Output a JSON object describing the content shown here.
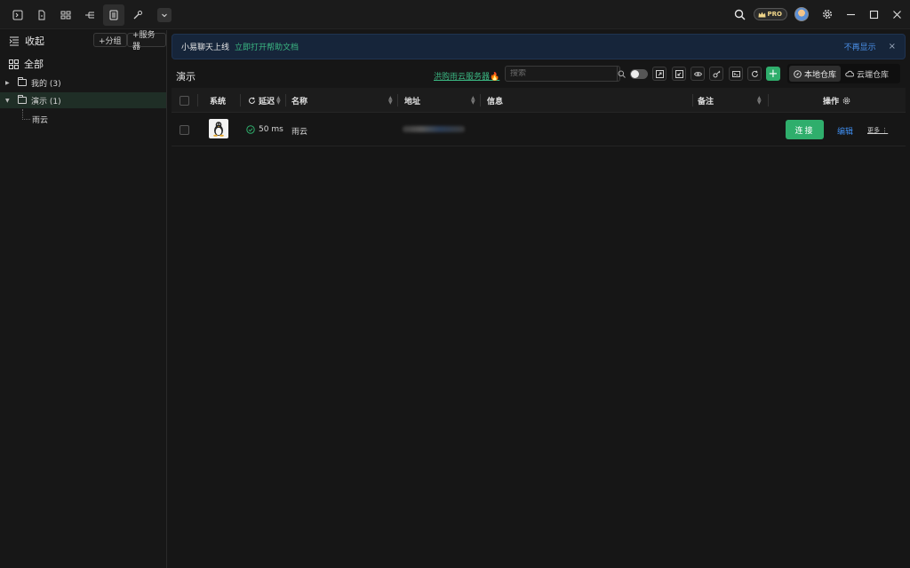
{
  "titlebar": {
    "tabs": [
      {
        "icon": "terminal-icon",
        "active": false
      },
      {
        "icon": "file-icon",
        "active": false
      },
      {
        "icon": "grid-icon",
        "active": false
      },
      {
        "icon": "tree-icon",
        "active": false
      },
      {
        "icon": "server-list-icon",
        "active": true
      },
      {
        "icon": "wrench-icon",
        "active": false
      }
    ],
    "pro_label": "PRO"
  },
  "sidebar": {
    "collapse_label": "收起",
    "all_label": "全部",
    "add_group": "+分组",
    "add_server": "+服务器",
    "groups": [
      {
        "label": "我的 (3)",
        "expanded": false,
        "selected": false
      },
      {
        "label": "演示 (1)",
        "expanded": true,
        "selected": true
      }
    ],
    "children": [
      "雨云"
    ]
  },
  "banner": {
    "text": "小易聊天上线",
    "link": "立即打开帮助文档",
    "dismiss": "不再显示",
    "close": "×"
  },
  "toolbar": {
    "title": "演示",
    "promo": "洪购雨云服务器🔥",
    "search_placeholder": "搜索",
    "local_repo": "本地仓库",
    "cloud_repo": "云端仓库"
  },
  "table": {
    "columns": {
      "system": "系统",
      "latency": "延迟",
      "name": "名称",
      "address": "地址",
      "info": "信息",
      "note": "备注",
      "actions": "操作"
    },
    "rows": [
      {
        "os": "linux",
        "latency": "50 ms",
        "name": "雨云",
        "address": "",
        "info": "",
        "note": "",
        "connect": "连接",
        "edit": "编辑",
        "more": "更多"
      }
    ]
  },
  "colors": {
    "accent": "#2fae6c",
    "link": "#3f8ef0",
    "banner_bg": "#16253a"
  }
}
